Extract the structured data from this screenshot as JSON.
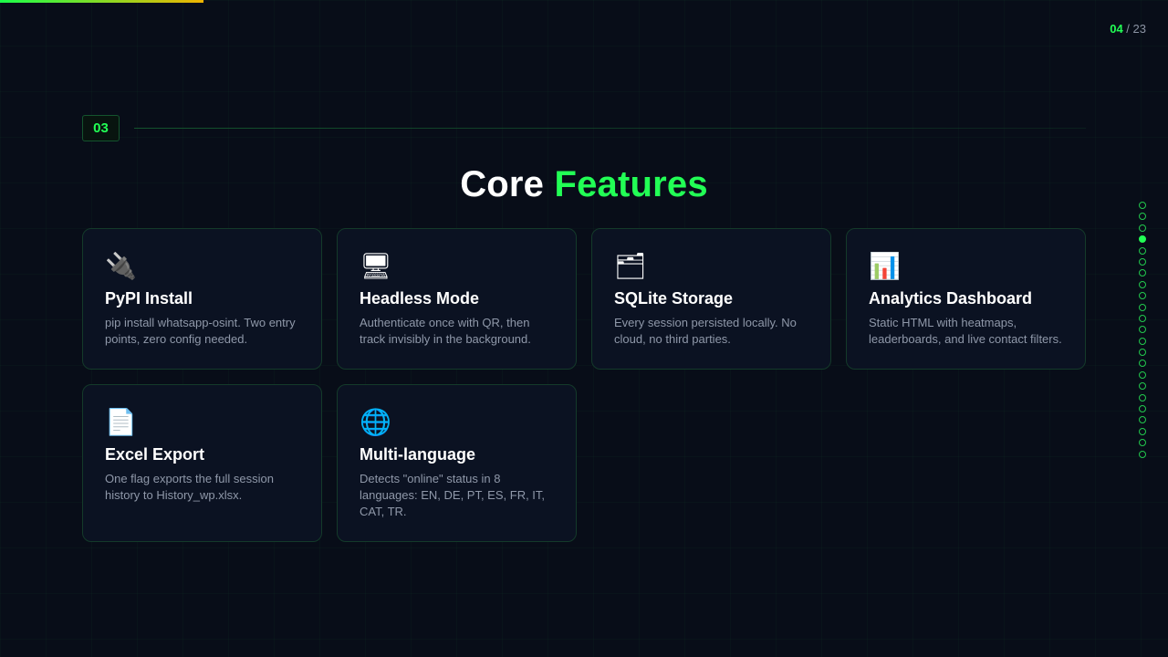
{
  "progress": {
    "fraction": 0.174
  },
  "page_counter": {
    "current": "04",
    "separator": " / ",
    "total": "23"
  },
  "section": {
    "number": "03"
  },
  "title": {
    "main": "Core",
    "accent": "Features"
  },
  "cards": [
    {
      "icon_name": "plug-icon",
      "icon": "🔌",
      "title": "PyPI Install",
      "description": "pip install whatsapp-osint. Two entry points, zero config needed."
    },
    {
      "icon_name": "monitor-icon",
      "icon": "🖥",
      "title": "Headless Mode",
      "description": "Authenticate once with QR, then track invisibly in the background."
    },
    {
      "icon_name": "folder-icon",
      "icon": "🗂",
      "title": "SQLite Storage",
      "description": "Every session persisted locally. No cloud, no third parties."
    },
    {
      "icon_name": "bar-chart-icon",
      "icon": "📊",
      "title": "Analytics Dashboard",
      "description": "Static HTML with heatmaps, leaderboards, and live contact filters."
    },
    {
      "icon_name": "document-icon",
      "icon": "📄",
      "title": "Excel Export",
      "description": "One flag exports the full session history to History_wp.xlsx."
    },
    {
      "icon_name": "globe-icon",
      "icon": "🌐",
      "title": "Multi-language",
      "description": "Detects \"online\" status in 8 languages: EN, DE, PT, ES, FR, IT, CAT, TR."
    }
  ],
  "slide_nav": {
    "total": 23,
    "active_index": 3
  },
  "colors": {
    "accent": "#22ff55",
    "background": "#080d18",
    "card": "#0b1222",
    "card_border": "#143a2a",
    "muted_text": "#8f98a9"
  }
}
